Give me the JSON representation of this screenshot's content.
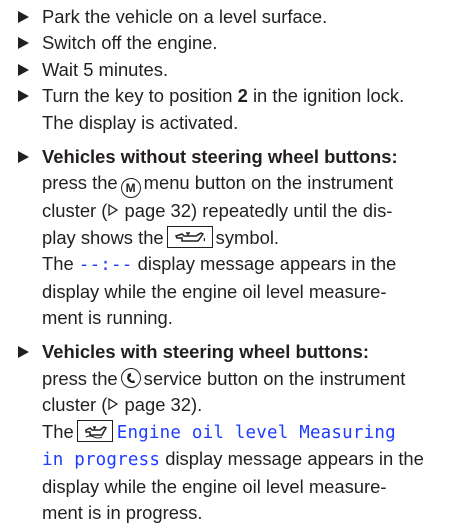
{
  "steps": [
    {
      "text": "Park the vehicle on a level surface."
    },
    {
      "text": "Switch off the engine."
    },
    {
      "text": "Wait 5 minutes."
    },
    {
      "pre": "Turn the key to position ",
      "bold": "2",
      "post": " in the ignition lock.",
      "line2": "The display is activated."
    },
    {
      "heading": "Vehicles without steering wheel buttons:",
      "l1_a": "press the",
      "l1_icon_label": "M",
      "l1_b": "menu button on the instrument",
      "l2": "cluster (",
      "l2_ref": "page 32) repeatedly until the dis-",
      "l3_a": "play shows the",
      "l3_b": "symbol.",
      "l4_a": "The",
      "l4_mono": "--:--",
      "l4_b": "display message appears in the",
      "l5": "display while the engine oil level measure-",
      "l6": "ment is running."
    },
    {
      "heading": "Vehicles with steering wheel buttons:",
      "l1_a": "press the",
      "l1_b": "service button on the instrument",
      "l2": "cluster (",
      "l2_ref": "page 32).",
      "l3_a": "The",
      "l3_mono": "Engine oil level Measuring",
      "l4_mono": "in progress",
      "l4_b": "display message appears in the",
      "l5": "display while the engine oil level measure-",
      "l6": "ment is in progress."
    }
  ],
  "icons": {
    "bullet": "right-triangle-bullet-icon",
    "ref_arrow": "page-reference-triangle-icon",
    "menu_button": "menu-button-m-icon",
    "service_button": "service-button-icon",
    "oil_can": "oil-can-icon"
  },
  "colors": {
    "text": "#231f20",
    "display_message": "#1e3cff"
  }
}
